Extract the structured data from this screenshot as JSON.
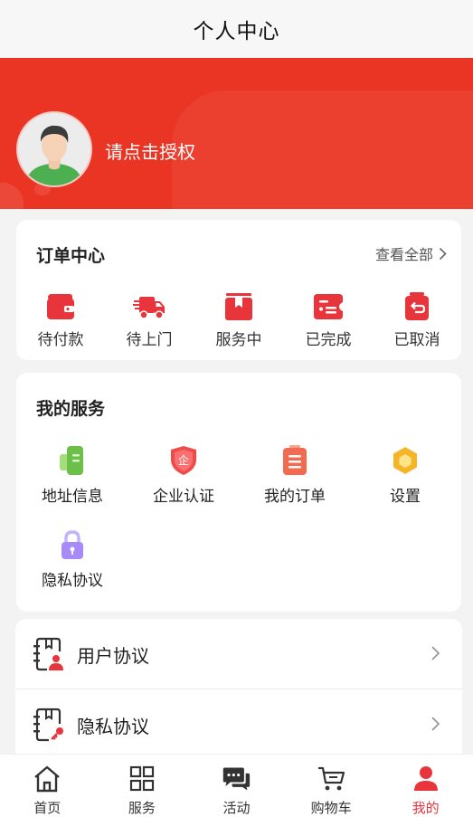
{
  "header": {
    "title": "个人中心"
  },
  "profile": {
    "auth_prompt": "请点击授权"
  },
  "orders": {
    "title": "订单中心",
    "view_all": "查看全部",
    "items": [
      {
        "label": "待付款",
        "icon": "wallet-icon"
      },
      {
        "label": "待上门",
        "icon": "delivery-truck-icon"
      },
      {
        "label": "服务中",
        "icon": "box-icon"
      },
      {
        "label": "已完成",
        "icon": "ticket-icon"
      },
      {
        "label": "已取消",
        "icon": "return-bag-icon"
      }
    ]
  },
  "services": {
    "title": "我的服务",
    "items": [
      {
        "label": "地址信息",
        "icon": "address-book-icon"
      },
      {
        "label": "企业认证",
        "icon": "enterprise-shield-icon"
      },
      {
        "label": "我的订单",
        "icon": "order-list-icon"
      },
      {
        "label": "设置",
        "icon": "settings-hexagon-icon"
      },
      {
        "label": "隐私协议",
        "icon": "lock-icon"
      }
    ]
  },
  "agreements": [
    {
      "label": "用户协议",
      "icon": "user-document-icon"
    },
    {
      "label": "隐私协议",
      "icon": "key-document-icon"
    }
  ],
  "tabbar": {
    "items": [
      {
        "label": "首页",
        "icon": "home-icon"
      },
      {
        "label": "服务",
        "icon": "grid-icon"
      },
      {
        "label": "活动",
        "icon": "chat-bubbles-icon"
      },
      {
        "label": "购物车",
        "icon": "cart-icon"
      },
      {
        "label": "我的",
        "icon": "person-icon",
        "active": true
      }
    ]
  },
  "colors": {
    "brand_red": "#ea3424",
    "active_tab": "#e8353b",
    "service_green": "#7ac943",
    "service_red": "#f04b4b",
    "service_orange": "#f26a4f",
    "service_yellow": "#f5b529",
    "service_purple": "#a78bfa"
  }
}
